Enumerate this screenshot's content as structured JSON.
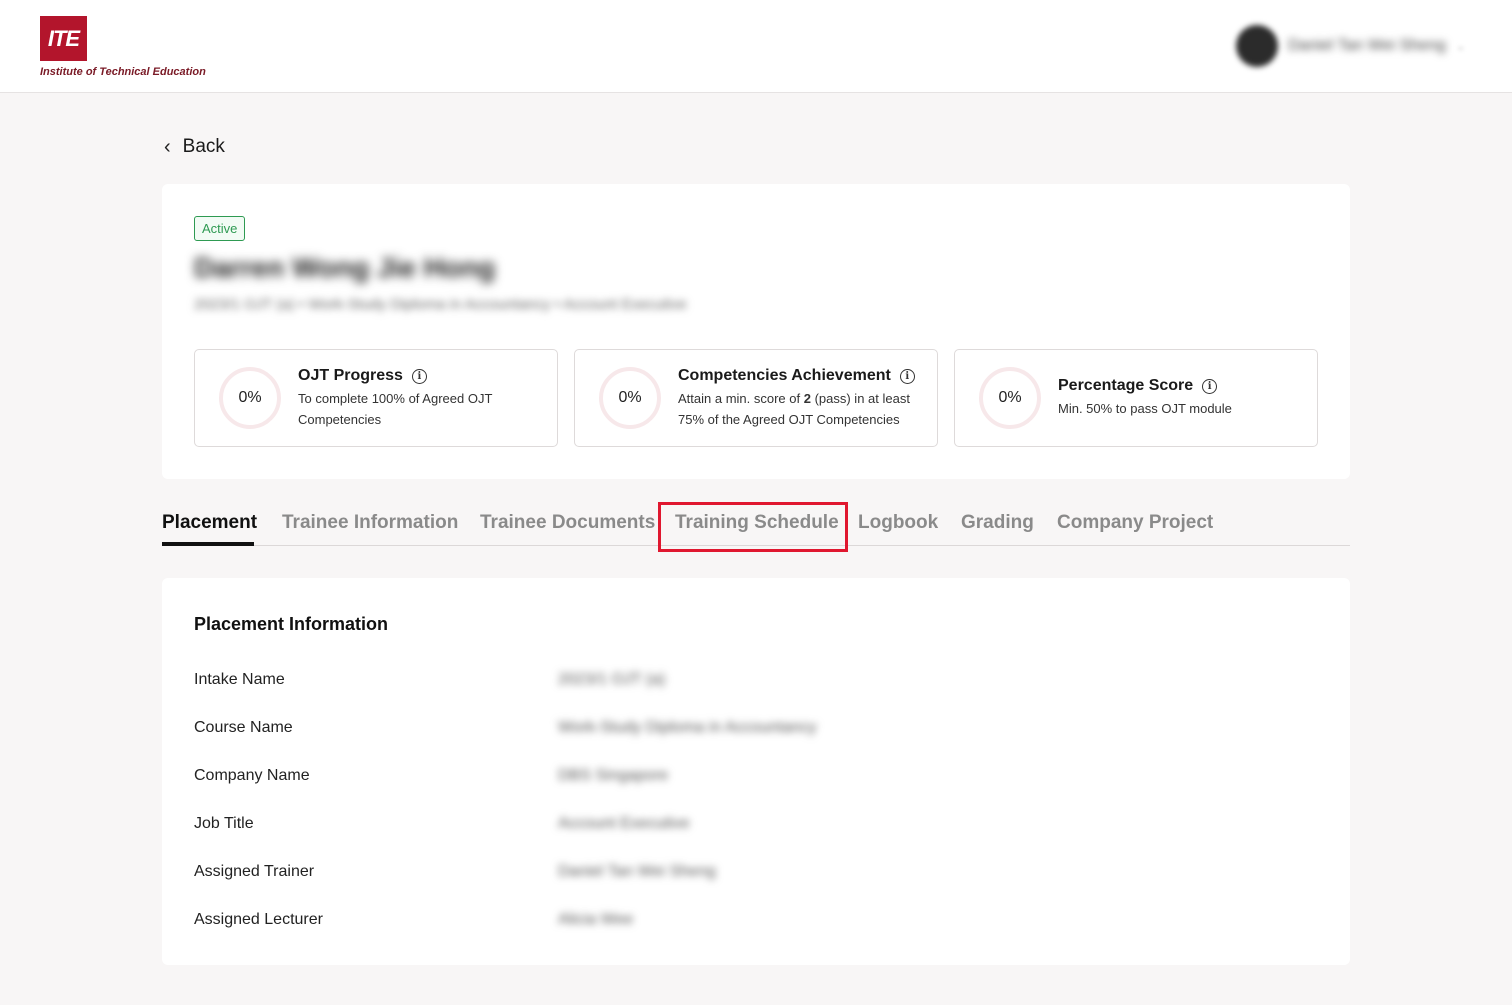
{
  "header": {
    "logo_mark": "ITE",
    "logo_text": "Institute of Technical Education",
    "user_name": "Daniel Tan Wei Sheng",
    "user_chevron": "⌄"
  },
  "back": {
    "icon": "‹",
    "label": "Back"
  },
  "profile": {
    "status": "Active",
    "name": "Darren Wong Jie Hong",
    "meta": "2023/1 OJT (a)  •  Work-Study Diploma in Accountancy  •  Account Executive"
  },
  "stats": [
    {
      "value": "0%",
      "title": "OJT Progress",
      "desc_pre": "To complete 100% of Agreed OJT Competencies",
      "desc_bold": "",
      "desc_post": ""
    },
    {
      "value": "0%",
      "title": "Competencies Achievement",
      "desc_pre": "Attain a min. score of ",
      "desc_bold": "2",
      "desc_post": " (pass) in at least 75% of the Agreed OJT Competencies"
    },
    {
      "value": "0%",
      "title": "Percentage Score",
      "desc_pre": "Min. 50% to pass OJT module",
      "desc_bold": "",
      "desc_post": ""
    }
  ],
  "info_glyph": "i",
  "tabs": [
    {
      "label": "Placement"
    },
    {
      "label": "Trainee Information"
    },
    {
      "label": "Trainee Documents"
    },
    {
      "label": "Training Schedule"
    },
    {
      "label": "Logbook"
    },
    {
      "label": "Grading"
    },
    {
      "label": "Company Project"
    }
  ],
  "placement": {
    "title": "Placement Information",
    "rows": [
      {
        "label": "Intake Name",
        "value": "2023/1 OJT (a)"
      },
      {
        "label": "Course Name",
        "value": "Work-Study Diploma in Accountancy"
      },
      {
        "label": "Company Name",
        "value": "DBS Singapore"
      },
      {
        "label": "Job Title",
        "value": "Account Executive"
      },
      {
        "label": "Assigned Trainer",
        "value": "Daniel Tan Wei Sheng"
      },
      {
        "label": "Assigned Lecturer",
        "value": "Alicia Wee"
      }
    ]
  }
}
